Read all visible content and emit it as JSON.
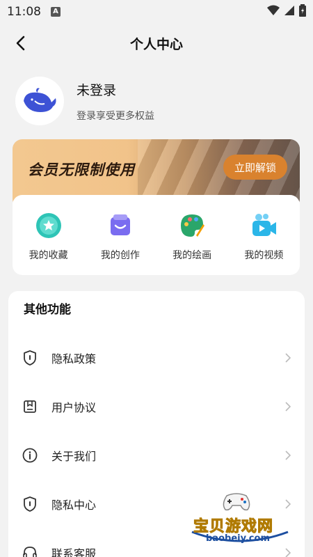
{
  "status_bar": {
    "time": "11:08",
    "notification_letter": "A"
  },
  "nav": {
    "title": "个人中心"
  },
  "profile": {
    "name": "未登录",
    "subtitle": "登录享受更多权益"
  },
  "vip_banner": {
    "title": "会员无限制使用",
    "button": "立即解锁"
  },
  "features": [
    {
      "label": "我的收藏",
      "icon": "star-collection-icon"
    },
    {
      "label": "我的创作",
      "icon": "creation-bag-icon"
    },
    {
      "label": "我的绘画",
      "icon": "palette-icon"
    },
    {
      "label": "我的视频",
      "icon": "video-camera-icon"
    }
  ],
  "other_functions": {
    "title": "其他功能",
    "items": [
      {
        "label": "隐私政策",
        "icon": "shield-icon"
      },
      {
        "label": "用户协议",
        "icon": "agreement-box-icon"
      },
      {
        "label": "关于我们",
        "icon": "info-icon"
      },
      {
        "label": "隐私中心",
        "icon": "shield-icon"
      },
      {
        "label": "联系客服",
        "icon": "headset-icon"
      }
    ]
  },
  "watermark": {
    "text": "宝贝游戏网",
    "url": "baobeiy.com"
  },
  "colors": {
    "accent": "#d9822e",
    "feature_teal": "#2ec4b6",
    "feature_purple": "#7a6cf0",
    "feature_cyan": "#2bb6e8"
  }
}
